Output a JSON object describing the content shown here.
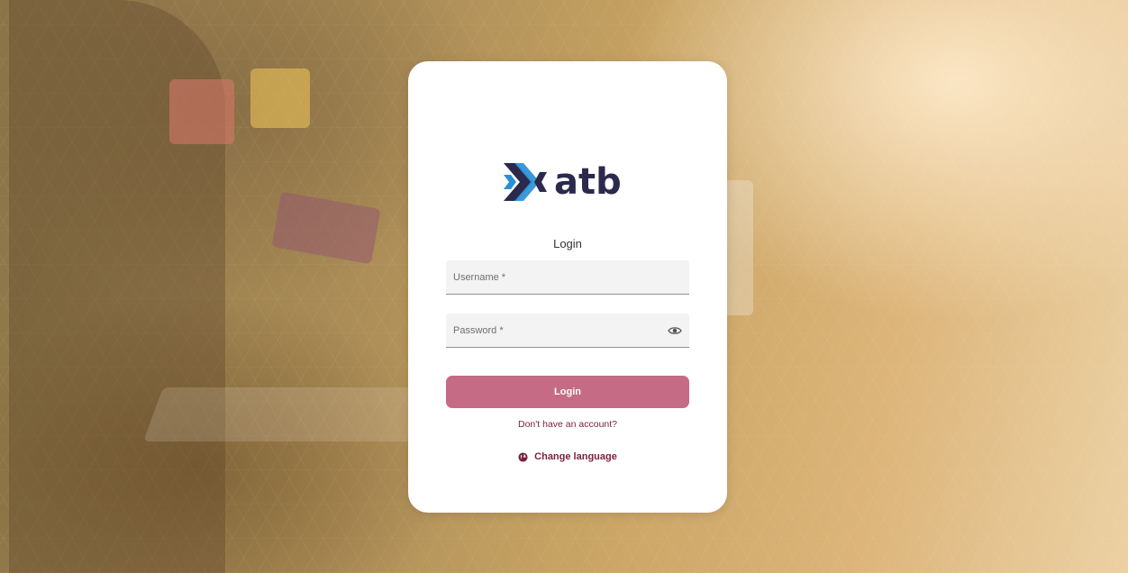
{
  "brand": {
    "name": "atb",
    "colors": {
      "logo_dark": "#2b2a4c",
      "logo_blue": "#2a8fd6",
      "accent": "#c56b85",
      "link": "#7a1f3d"
    }
  },
  "login_form": {
    "title": "Login",
    "username": {
      "placeholder": "Username *",
      "value": ""
    },
    "password": {
      "placeholder": "Password *",
      "value": "",
      "toggle_icon": "eye-icon"
    },
    "submit_label": "Login",
    "signup_link": "Don't have an account?",
    "language": {
      "label": "Change language",
      "icon": "globe-icon"
    }
  }
}
